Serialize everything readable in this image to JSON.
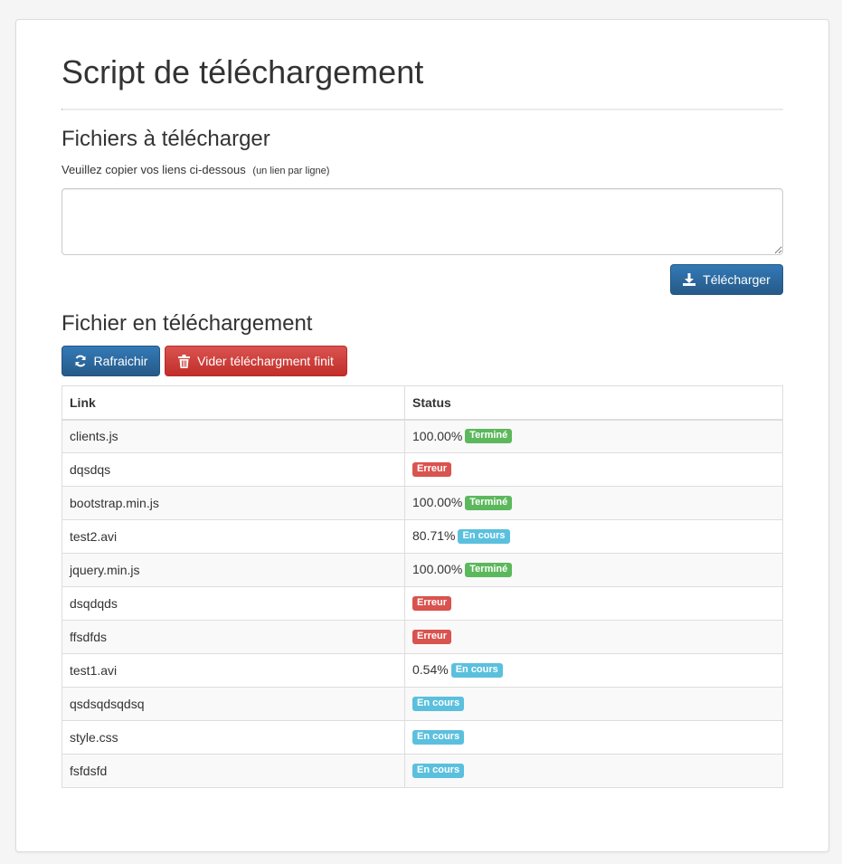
{
  "page": {
    "title": "Script de téléchargement"
  },
  "files_section": {
    "heading": "Fichiers à télécharger",
    "instruction": "Veuillez copier vos liens ci-dessous",
    "instruction_hint": "(un lien par ligne)",
    "textarea_value": "",
    "download_button": "Télécharger",
    "download_icon": "download-icon"
  },
  "current_section": {
    "heading": "Fichier en téléchargement",
    "refresh_button": "Rafraichir",
    "refresh_icon": "refresh-icon",
    "clear_button": "Vider téléchargment finit",
    "clear_icon": "trash-icon"
  },
  "table": {
    "headers": [
      "Link",
      "Status"
    ],
    "rows": [
      {
        "link": "clients.js",
        "progress": "100.00%",
        "status": "Terminé",
        "type": "success"
      },
      {
        "link": "dqsdqs",
        "progress": "",
        "status": "Erreur",
        "type": "danger"
      },
      {
        "link": "bootstrap.min.js",
        "progress": "100.00%",
        "status": "Terminé",
        "type": "success"
      },
      {
        "link": "test2.avi",
        "progress": "80.71%",
        "status": "En cours",
        "type": "info"
      },
      {
        "link": "jquery.min.js",
        "progress": "100.00%",
        "status": "Terminé",
        "type": "success"
      },
      {
        "link": "dsqdqds",
        "progress": "",
        "status": "Erreur",
        "type": "danger"
      },
      {
        "link": "ffsdfds",
        "progress": "",
        "status": "Erreur",
        "type": "danger"
      },
      {
        "link": "test1.avi",
        "progress": "0.54%",
        "status": "En cours",
        "type": "info"
      },
      {
        "link": "qsdsqdsqdsq",
        "progress": "",
        "status": "En cours",
        "type": "info"
      },
      {
        "link": "style.css",
        "progress": "",
        "status": "En cours",
        "type": "info"
      },
      {
        "link": "fsfdsfd",
        "progress": "",
        "status": "En cours",
        "type": "info"
      }
    ]
  },
  "colors": {
    "primary": "#337ab7",
    "danger": "#d9534f",
    "success": "#5cb85c",
    "info": "#5bc0de"
  }
}
